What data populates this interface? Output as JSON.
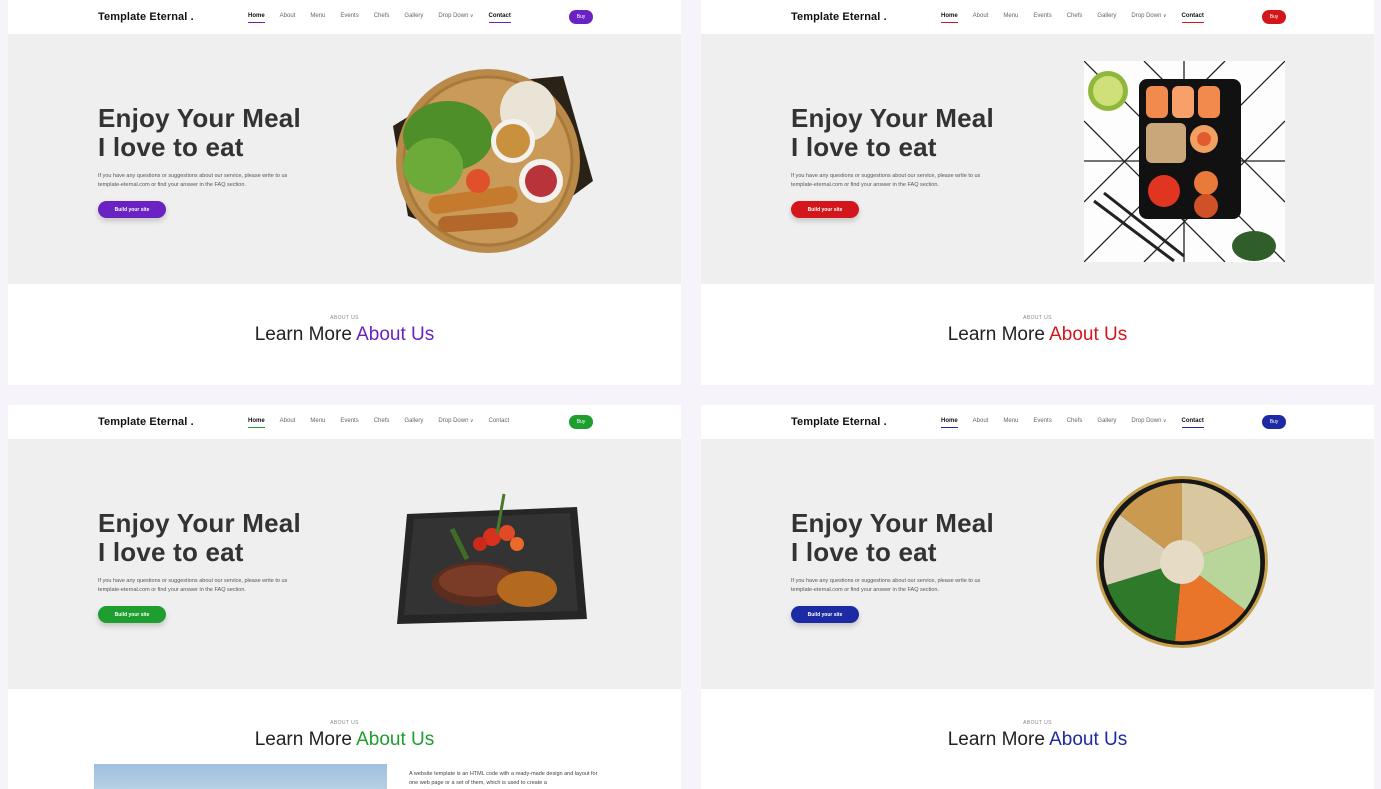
{
  "brand": "Template Eternal .",
  "nav": [
    "Home",
    "About",
    "Menu",
    "Events",
    "Chefs",
    "Gallery",
    "Drop Down",
    "Contact"
  ],
  "buy_label": "Buy",
  "hero": {
    "title_line1": "Enjoy Your Meal",
    "title_line2": "I love to eat",
    "text": "If you have any questions or suggestions about our service, please write to us template-eternal.com or find your answer in the FAQ section.",
    "cta": "Build your site"
  },
  "about": {
    "kicker": "ABOUT US",
    "title_plain": "Learn More",
    "title_accent": "About Us",
    "body": "A website template is an HTML code with a ready-made design and layout for one web page or a set of them, which is used to create a"
  },
  "variants": [
    {
      "accent": "#6a22c2",
      "food": "spring-rolls-basket"
    },
    {
      "accent": "#d2161c",
      "food": "sushi-box"
    },
    {
      "accent": "#1e9e2e",
      "food": "steak-plate"
    },
    {
      "accent": "#1c2aa4",
      "food": "poke-bowl"
    }
  ]
}
